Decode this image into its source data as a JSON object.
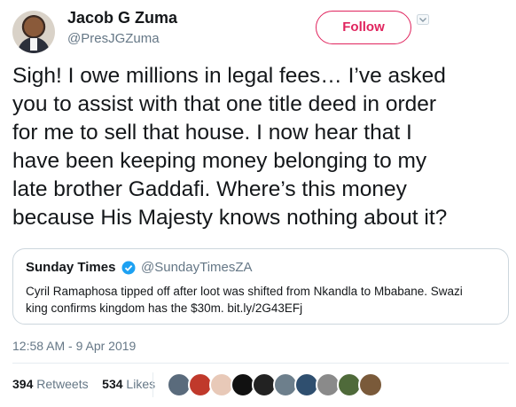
{
  "author": {
    "name": "Jacob G Zuma",
    "handle": "@PresJGZuma",
    "avatar_icon": "profile-photo"
  },
  "follow": {
    "label": "Follow",
    "color": "#e0245e"
  },
  "tweet": {
    "lines": [
      "Sigh! I owe millions in legal fees… I’ve asked",
      "you to assist with that one title deed in order",
      "for me to sell that house. I now hear that I",
      "have been keeping money belonging to my",
      "late brother Gaddafi. Where’s this money",
      "because His Majesty knows nothing about it?"
    ]
  },
  "quoted": {
    "name": "Sunday Times",
    "verified_icon": "verified-badge-icon",
    "handle": "@SundayTimesZA",
    "lines": [
      "Cyril Ramaphosa tipped off after loot was shifted from Nkandla to Mbabane. Swazi",
      "king confirms kingdom has the $30m.  bit.ly/2G43EFj"
    ]
  },
  "timestamp": "12:58 AM - 9 Apr 2019",
  "stats": {
    "retweets_count": "394",
    "retweets_label": "Retweets",
    "likes_count": "534",
    "likes_label": "Likes"
  },
  "likers": [
    {
      "color": "#5a6b7c"
    },
    {
      "color": "#c0392b"
    },
    {
      "color": "#e8c9b8"
    },
    {
      "color": "#111111"
    },
    {
      "color": "#222222"
    },
    {
      "color": "#6d7f8c"
    },
    {
      "color": "#2f4f6f"
    },
    {
      "color": "#8a8a8a"
    },
    {
      "color": "#4f6a3a"
    },
    {
      "color": "#7a5a3a"
    }
  ]
}
